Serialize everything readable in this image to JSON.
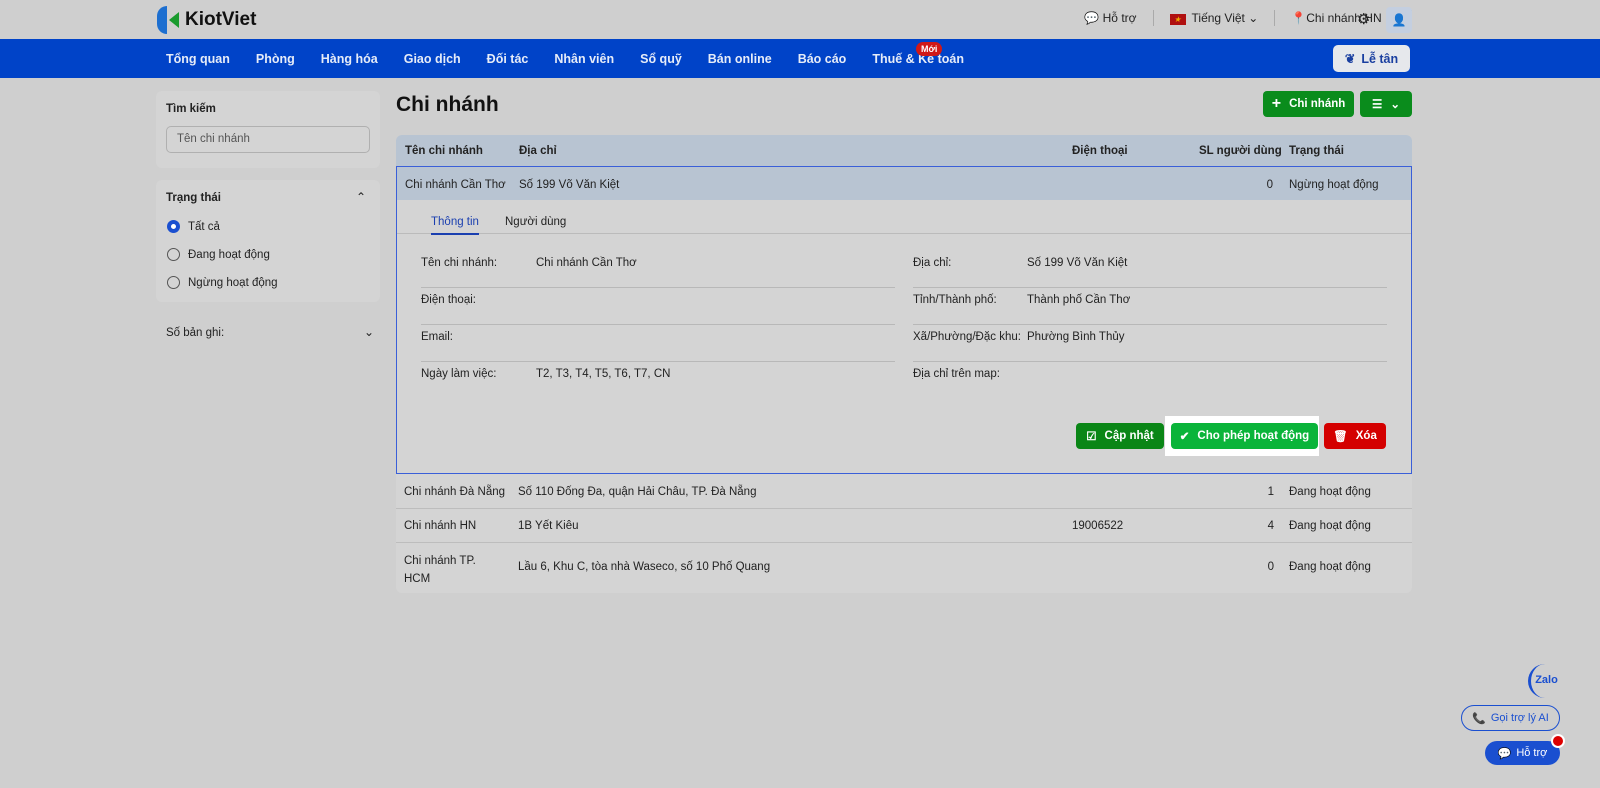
{
  "brand": {
    "name": "KiotViet"
  },
  "topbar": {
    "support": "Hỗ trợ",
    "language": "Tiếng Việt",
    "branch": "Chi nhánh HN"
  },
  "nav": {
    "items": [
      "Tổng quan",
      "Phòng",
      "Hàng hóa",
      "Giao dịch",
      "Đối tác",
      "Nhân viên",
      "Sổ quỹ",
      "Bán online",
      "Báo cáo",
      "Thuế & Kế toán"
    ],
    "new_badge": "Mới",
    "reception": "Lễ tân"
  },
  "sidebar": {
    "search_label": "Tìm kiếm",
    "search_placeholder": "Tên chi nhánh",
    "status_label": "Trạng thái",
    "status_options": [
      "Tất cả",
      "Đang hoạt động",
      "Ngừng hoạt động"
    ],
    "status_selected": "Tất cả",
    "records_label": "Số bản ghi:"
  },
  "page": {
    "title": "Chi nhánh",
    "add_button": "Chi nhánh"
  },
  "table": {
    "columns": [
      "Tên chi nhánh",
      "Địa chỉ",
      "Điện thoại",
      "SL người dùng",
      "Trạng thái"
    ],
    "rows": [
      {
        "name": "Chi nhánh Cần Thơ",
        "address": "Số 199 Võ Văn Kiệt",
        "phone": "",
        "users": "0",
        "status": "Ngừng hoạt động"
      },
      {
        "name": "Chi nhánh Đà Nẵng",
        "address": "Số 110 Đống Đa, quận Hải Châu, TP. Đà Nẵng",
        "phone": "",
        "users": "1",
        "status": "Đang hoạt động"
      },
      {
        "name": "Chi nhánh HN",
        "address": "1B Yết Kiêu",
        "phone": "19006522",
        "users": "4",
        "status": "Đang hoạt động"
      },
      {
        "name": "Chi nhánh TP. HCM",
        "address": "Lầu 6, Khu C, tòa nhà Waseco, số 10 Phố Quang",
        "phone": "",
        "users": "0",
        "status": "Đang hoạt động"
      }
    ]
  },
  "detail": {
    "tabs": [
      "Thông tin",
      "Người dùng"
    ],
    "left": [
      {
        "label": "Tên chi nhánh:",
        "value": "Chi nhánh Cần Thơ"
      },
      {
        "label": "Điện thoại:",
        "value": ""
      },
      {
        "label": "Email:",
        "value": ""
      },
      {
        "label": "Ngày làm việc:",
        "value": "T2, T3, T4, T5, T6, T7, CN"
      }
    ],
    "right": [
      {
        "label": "Địa chỉ:",
        "value": "Số 199 Võ Văn Kiệt"
      },
      {
        "label": "Tỉnh/Thành phố:",
        "value": "Thành phố Cần Thơ"
      },
      {
        "label": "Xã/Phường/Đặc khu:",
        "value": "Phường Bình Thủy"
      },
      {
        "label": "Địa chỉ trên map:",
        "value": ""
      }
    ],
    "update": "Cập nhật",
    "activate": "Cho phép hoạt động",
    "delete": "Xóa"
  },
  "floating": {
    "zalo": "Zalo",
    "ai": "Gọi trợ lý AI",
    "support": "Hỗ trợ"
  },
  "colors": {
    "nav": "#0043c8",
    "green": "#0a8c1c",
    "activate": "#0ab43a",
    "danger": "#d40000"
  }
}
